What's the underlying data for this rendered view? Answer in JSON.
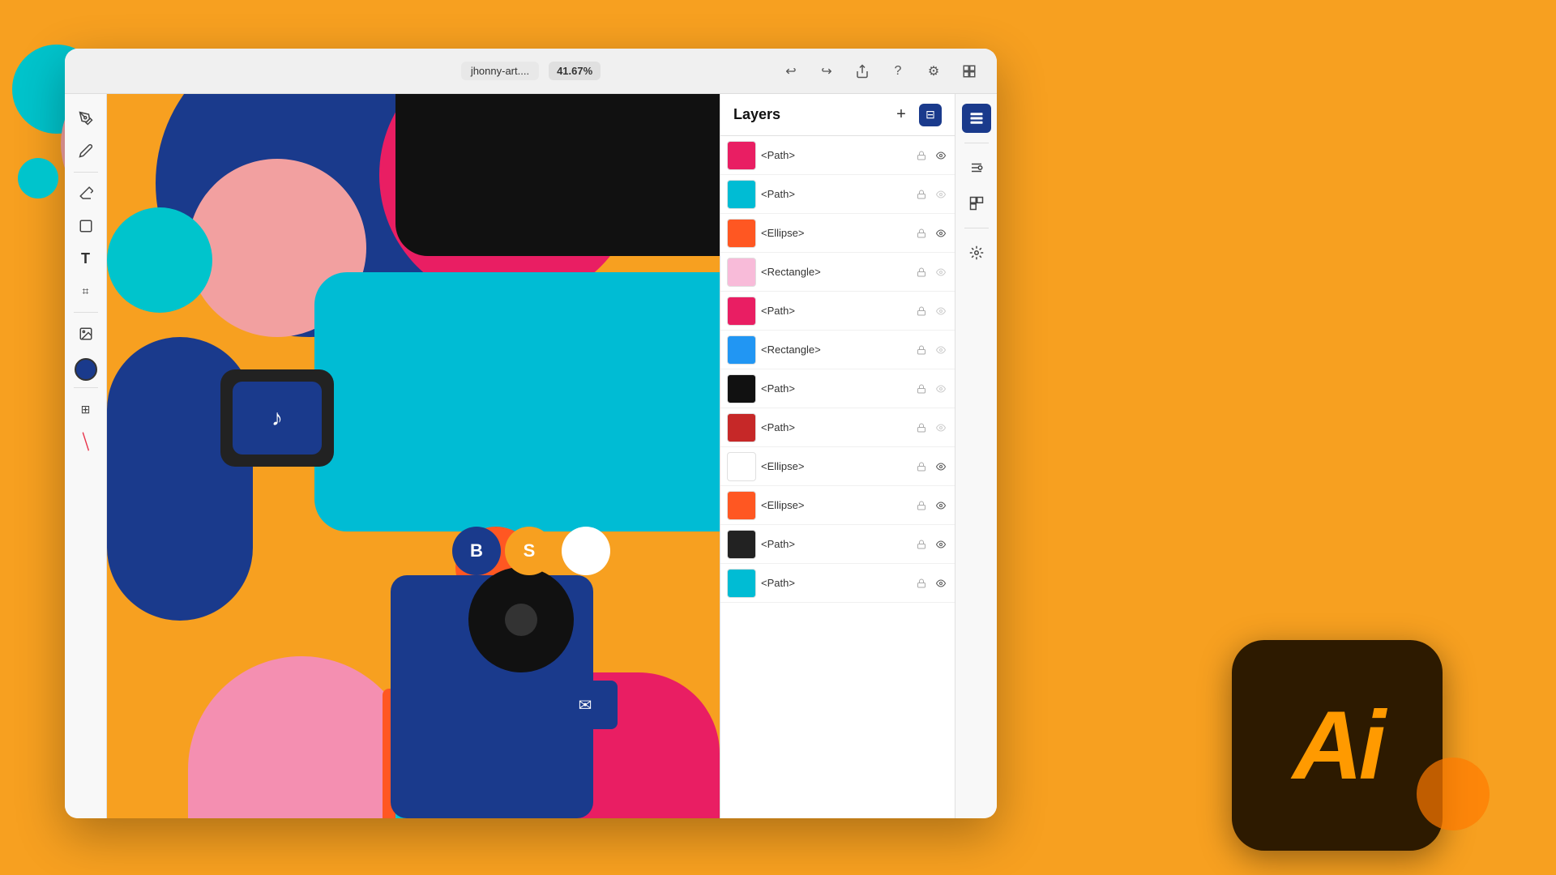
{
  "background": {
    "color": "#F7A020"
  },
  "titlebar": {
    "filename": "jhonny-art....",
    "zoom": "41.67%",
    "undo_label": "↩",
    "redo_label": "↪",
    "share_label": "⬆",
    "help_label": "?",
    "settings_label": "⚙",
    "tools_label": "⊞"
  },
  "left_toolbar": {
    "tools": [
      {
        "name": "pen-tool",
        "icon": "✒",
        "label": "Pen"
      },
      {
        "name": "pencil-tool",
        "icon": "✏",
        "label": "Pencil"
      },
      {
        "name": "eraser-tool",
        "icon": "◻",
        "label": "Eraser"
      },
      {
        "name": "shape-tool",
        "icon": "▭",
        "label": "Shape"
      },
      {
        "name": "text-tool",
        "icon": "T",
        "label": "Text"
      },
      {
        "name": "crop-tool",
        "icon": "⌗",
        "label": "Crop"
      },
      {
        "name": "image-tool",
        "icon": "🖼",
        "label": "Image"
      },
      {
        "name": "brush-stroke-tool",
        "icon": "/",
        "label": "Brush"
      }
    ],
    "color_value": "#1a3a8c",
    "grid_icon": "⊞"
  },
  "layers_panel": {
    "title": "Layers",
    "add_button_label": "+",
    "items": [
      {
        "name": "layer-path-1",
        "label": "<Path>",
        "thumb_color": "#E91E63",
        "has_lock": true,
        "has_eye": true
      },
      {
        "name": "layer-path-2",
        "label": "<Path>",
        "thumb_color": "#00BCD4",
        "has_lock": true,
        "has_eye": false
      },
      {
        "name": "layer-ellipse-1",
        "label": "<Ellipse>",
        "thumb_color": "#FF5722",
        "has_lock": true,
        "has_eye": true
      },
      {
        "name": "layer-rectangle-1",
        "label": "<Rectangle>",
        "thumb_color": "#F8BBD9",
        "has_lock": true,
        "has_eye": false
      },
      {
        "name": "layer-path-3",
        "label": "<Path>",
        "thumb_color": "#E91E63",
        "has_lock": true,
        "has_eye": false
      },
      {
        "name": "layer-rectangle-2",
        "label": "<Rectangle>",
        "thumb_color": "#2196F3",
        "has_lock": true,
        "has_eye": false
      },
      {
        "name": "layer-path-4",
        "label": "<Path>",
        "thumb_color": "#111111",
        "has_lock": true,
        "has_eye": false
      },
      {
        "name": "layer-path-5",
        "label": "<Path>",
        "thumb_color": "#C62828",
        "has_lock": true,
        "has_eye": false
      },
      {
        "name": "layer-ellipse-2",
        "label": "<Ellipse>",
        "thumb_color": "#FFFFFF",
        "has_lock": true,
        "has_eye": true
      },
      {
        "name": "layer-ellipse-3",
        "label": "<Ellipse>",
        "thumb_color": "#FF5722",
        "has_lock": true,
        "has_eye": true
      },
      {
        "name": "layer-path-6",
        "label": "<Path>",
        "thumb_color": "#222222",
        "has_lock": true,
        "has_eye": true
      },
      {
        "name": "layer-path-7",
        "label": "<Path>",
        "thumb_color": "#00BCD4",
        "has_lock": true,
        "has_eye": true
      }
    ]
  },
  "right_sidebar": {
    "tools": [
      {
        "name": "layers-active",
        "icon": "⊟",
        "active": true
      },
      {
        "name": "properties",
        "icon": "≡",
        "active": false
      },
      {
        "name": "library",
        "icon": "◫",
        "active": false
      },
      {
        "name": "arrange",
        "icon": "✦",
        "active": false
      }
    ]
  },
  "ai_logo": {
    "text": "Ai"
  }
}
